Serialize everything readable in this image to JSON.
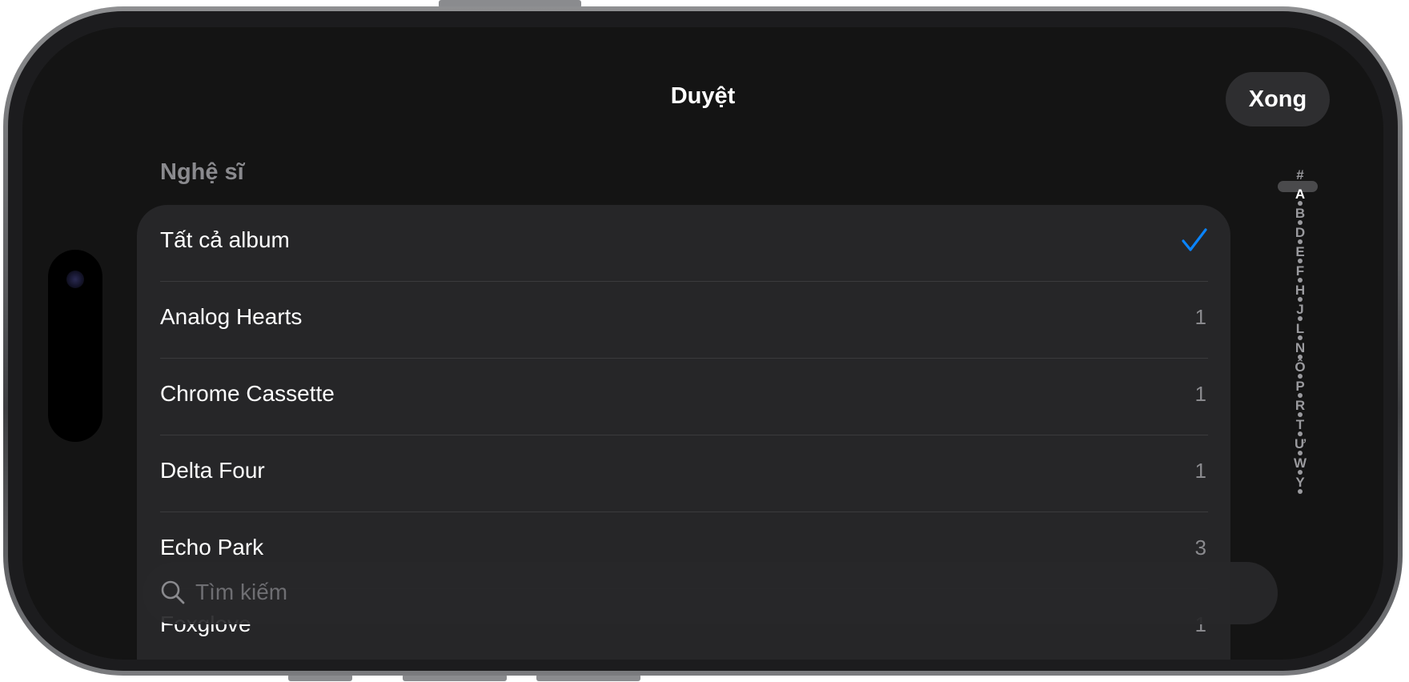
{
  "nav": {
    "title": "Duyệt",
    "done_label": "Xong"
  },
  "section": {
    "header": "Nghệ sĩ"
  },
  "rows": [
    {
      "label": "Tất cả album",
      "count": "",
      "selected": true
    },
    {
      "label": "Analog Hearts",
      "count": "1",
      "selected": false
    },
    {
      "label": "Chrome Cassette",
      "count": "1",
      "selected": false
    },
    {
      "label": "Delta Four",
      "count": "1",
      "selected": false
    },
    {
      "label": "Echo Park",
      "count": "3",
      "selected": false
    },
    {
      "label": "Foxglove",
      "count": "1",
      "selected": false
    }
  ],
  "index": {
    "letters": [
      "#",
      "A",
      "B",
      "D",
      "E",
      "F",
      "H",
      "J",
      "L",
      "N",
      "Ô",
      "P",
      "R",
      "T",
      "Ư",
      "W",
      "Y"
    ],
    "active": "A"
  },
  "search": {
    "placeholder": "Tìm kiếm",
    "value": ""
  },
  "colors": {
    "accent": "#0a84ff",
    "background": "#141414",
    "card": "#262628",
    "secondary_text": "#8a8a8e"
  },
  "icons": {
    "checkmark": "checkmark-icon",
    "search": "search-icon"
  }
}
